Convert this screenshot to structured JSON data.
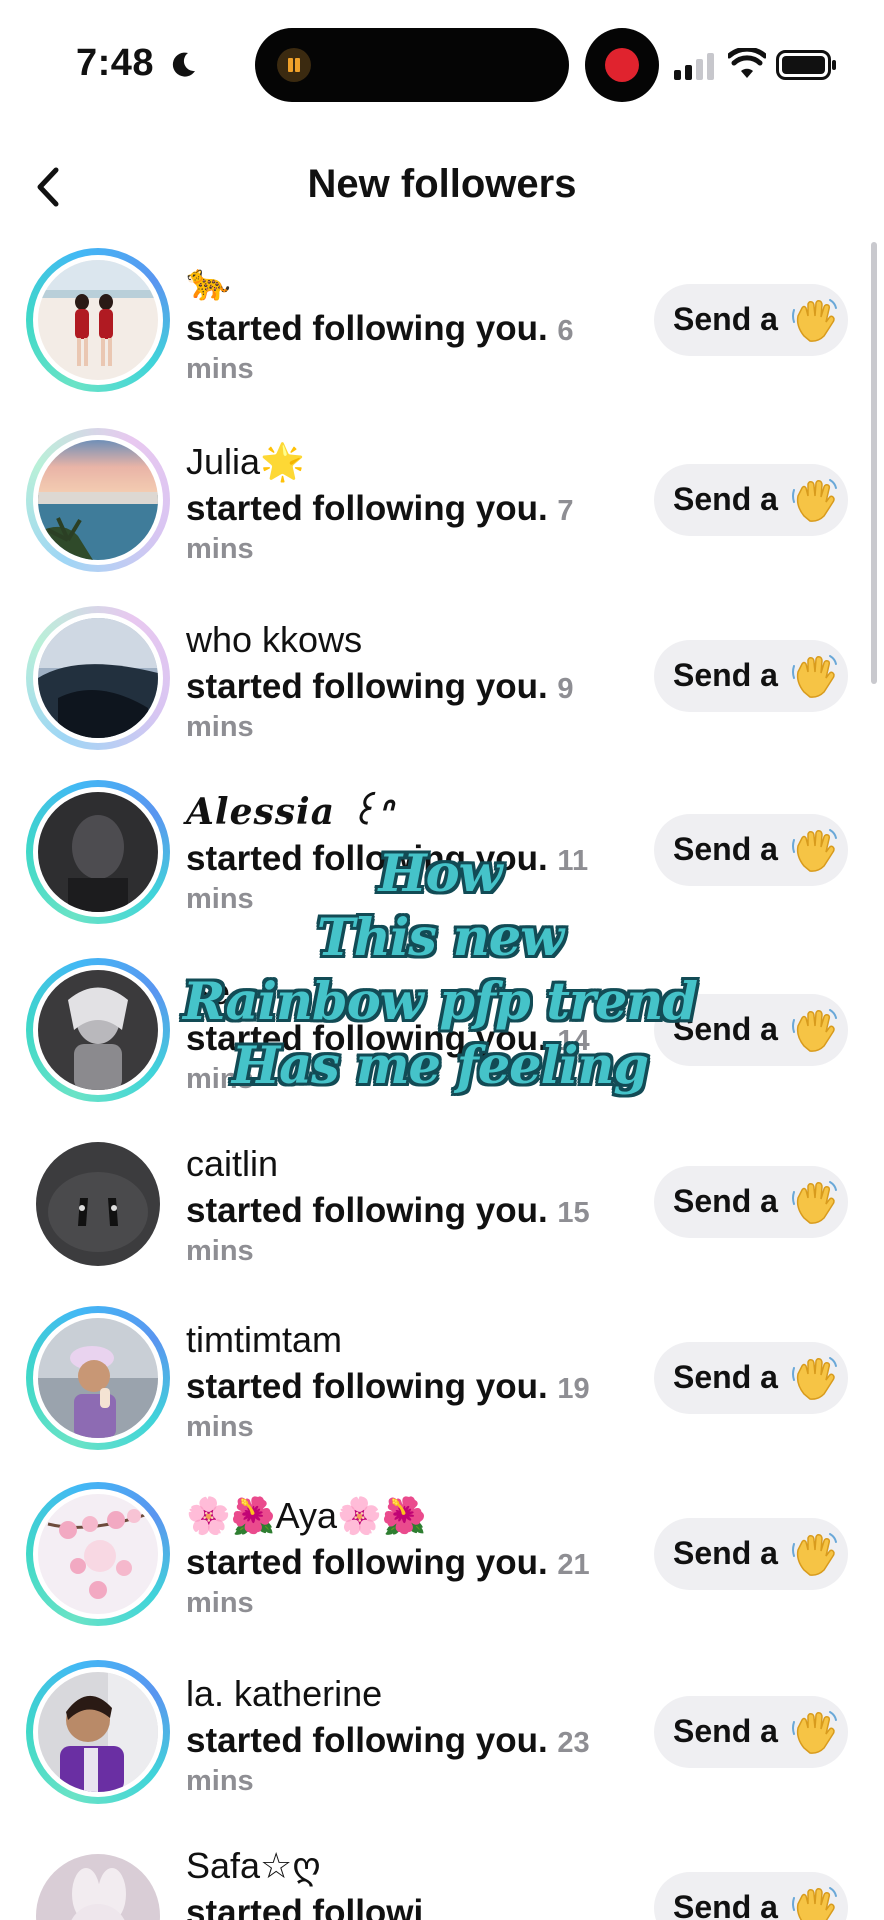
{
  "status_bar": {
    "time": "7:48"
  },
  "header": {
    "title": "New followers"
  },
  "followers": [
    {
      "name": "🐆",
      "action": "started following you.",
      "ago": "6",
      "unit": "mins",
      "button": "Send a"
    },
    {
      "name": "Julia🌟",
      "action": "started following you.",
      "ago": "7",
      "unit": "mins",
      "button": "Send a"
    },
    {
      "name": "who kkows",
      "action": "started following you.",
      "ago": "9",
      "unit": "mins",
      "button": "Send a"
    },
    {
      "name": "Alessia ꒰ᐢ",
      "action": "started following you.",
      "ago": "11",
      "unit": "mins",
      "button": "Send a"
    },
    {
      "name": "Se",
      "action": "started following you.",
      "ago": "14",
      "unit": "mins",
      "button": "Send a"
    },
    {
      "name": "caitlin",
      "action": "started following you.",
      "ago": "15",
      "unit": "mins",
      "button": "Send a"
    },
    {
      "name": "timtimtam",
      "action": "started following you.",
      "ago": "19",
      "unit": "mins",
      "button": "Send a"
    },
    {
      "name": "🌸🌺Aya🌸🌺",
      "action": "started following you.",
      "ago": "21",
      "unit": "mins",
      "button": "Send a"
    },
    {
      "name": "la. katherine",
      "action": "started following you.",
      "ago": "23",
      "unit": "mins",
      "button": "Send a"
    },
    {
      "name": "Safa☆ღ",
      "action": "started followi",
      "ago": "",
      "unit": "",
      "button": "Send a"
    }
  ],
  "overlay_caption": {
    "line1": "How",
    "line2": "This new",
    "line3": "Rainbow pfp trend",
    "line4": "Has me feeling"
  },
  "colors": {
    "ring_gradient": [
      "#6ae3c6",
      "#42b8f5",
      "#5a95f0"
    ],
    "caption_fill": "#45c3c9",
    "caption_stroke": "#124b55",
    "button_bg": "#efeff2"
  },
  "icons": {
    "back": "chevron-left-icon",
    "wave": "waving-hand-icon",
    "moon": "moon-icon",
    "signal": "cellular-signal-icon",
    "wifi": "wifi-icon",
    "battery": "battery-icon"
  }
}
